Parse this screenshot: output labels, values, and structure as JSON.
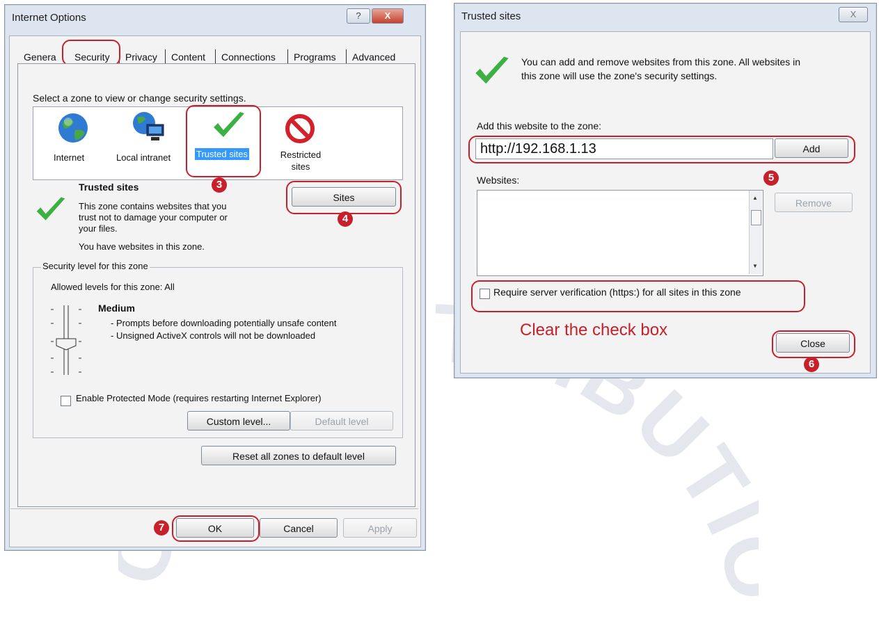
{
  "internet_options": {
    "title": "Internet Options",
    "help_btn": "?",
    "close_btn": "X",
    "tabs": [
      "Genera",
      "Security",
      "Privacy",
      "Content",
      "Connections",
      "Programs",
      "Advanced"
    ],
    "zone_prompt": "Select a zone to view or change security settings.",
    "zones": [
      "Internet",
      "Local intranet",
      "Trusted sites",
      "Restricted sites"
    ],
    "zone_title": "Trusted sites",
    "zone_desc": [
      "This zone contains websites that you",
      "trust not to damage your computer or",
      "your files.",
      "You have websites in this zone."
    ],
    "sites_button": "Sites",
    "security_group": "Security level for this zone",
    "allowed_levels": "Allowed levels for this zone: All",
    "level_name": "Medium",
    "level_points": [
      "- Prompts before downloading potentially unsafe content",
      "- Unsigned ActiveX controls will not be downloaded"
    ],
    "protected_mode": "Enable Protected Mode (requires restarting Internet Explorer)",
    "custom_level": "Custom level...",
    "default_level": "Default level",
    "reset_all": "Reset all zones to default level",
    "ok": "OK",
    "cancel": "Cancel",
    "apply": "Apply"
  },
  "trusted_sites": {
    "title": "Trusted sites",
    "close_btn": "X",
    "info": [
      "You can add and remove websites from this zone. All websites in",
      "this zone will use the zone's security settings."
    ],
    "add_label": "Add this website to the zone:",
    "url_value": "http://192.168.1.13",
    "add_button": "Add",
    "websites_label": "Websites:",
    "remove_button": "Remove",
    "require_https": "Require server verification (https:) for all sites in this zone",
    "close_button": "Close"
  },
  "annotation": "Clear the check box",
  "steps": [
    "3",
    "4",
    "5",
    "6",
    "7"
  ],
  "watermark": [
    "CAM DISTRIBUTION"
  ],
  "colors": {
    "highlight_red": "#c8202a",
    "selection_blue": "#3399ff",
    "check_green": "#3cb043",
    "restricted_red": "#d3202a"
  }
}
